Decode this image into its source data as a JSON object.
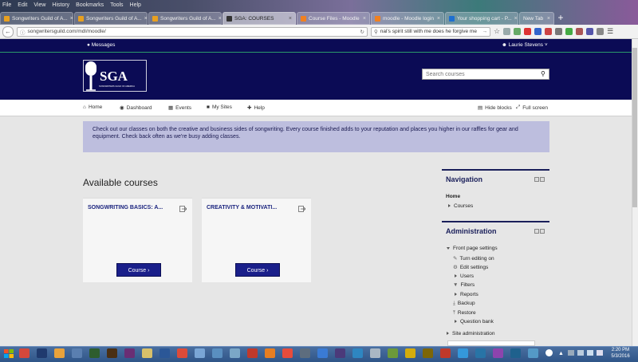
{
  "browser": {
    "menu": [
      "File",
      "Edit",
      "View",
      "History",
      "Bookmarks",
      "Tools",
      "Help"
    ],
    "tabs": [
      {
        "label": "Songwriters Guild of A...",
        "active": false
      },
      {
        "label": "Songwriters Guild of A...",
        "active": false
      },
      {
        "label": "Songwriters Guild of A...",
        "active": false
      },
      {
        "label": "SGA: COURSES",
        "active": true
      },
      {
        "label": "Course Files - Moodle",
        "active": false
      },
      {
        "label": "moodle - Moodle login",
        "active": false
      },
      {
        "label": "Your shopping cart - P...",
        "active": false
      },
      {
        "label": "New Tab",
        "active": false
      }
    ],
    "url": "songwritersguild.com/mdl/moodle/",
    "search_text": "nal's spirit still with me does he forgive me"
  },
  "site": {
    "messages": "Messages",
    "user": "Laurie Stevens",
    "logo_text": "SGA",
    "logo_subtext": "SONGWRITERS GUILD OF AMERICA",
    "search_placeholder": "Search courses",
    "nav": [
      {
        "label": "Home",
        "icon": "home-icon"
      },
      {
        "label": "Dashboard",
        "icon": "dashboard-icon"
      },
      {
        "label": "Events",
        "icon": "calendar-icon"
      },
      {
        "label": "My Sites",
        "icon": "briefcase-icon"
      },
      {
        "label": "Help",
        "icon": "lifebuoy-icon"
      }
    ],
    "hide_blocks": "Hide blocks",
    "full_screen": "Full screen",
    "notice": "Check out our classes on both the creative and business sides of songwriting. Every course finished adds to your reputation and places you higher in our raffles for gear and equipment. Check back often as we're busy adding classes.",
    "available_courses": "Available courses",
    "courses": [
      {
        "title": "SONGWRITING BASICS: A...",
        "button": "Course"
      },
      {
        "title": "CREATIVITY & MOTIVATI...",
        "button": "Course"
      }
    ],
    "navigation_block": {
      "title": "Navigation",
      "home": "Home",
      "courses": "Courses"
    },
    "admin_block": {
      "title": "Administration",
      "front_page_settings": "Front page settings",
      "items": [
        "Turn editing on",
        "Edit settings",
        "Users",
        "Filters",
        "Reports",
        "Backup",
        "Restore",
        "Question bank"
      ],
      "site_admin": "Site administration"
    }
  },
  "taskbar": {
    "time": "2:20 PM",
    "date": "5/3/2016"
  }
}
